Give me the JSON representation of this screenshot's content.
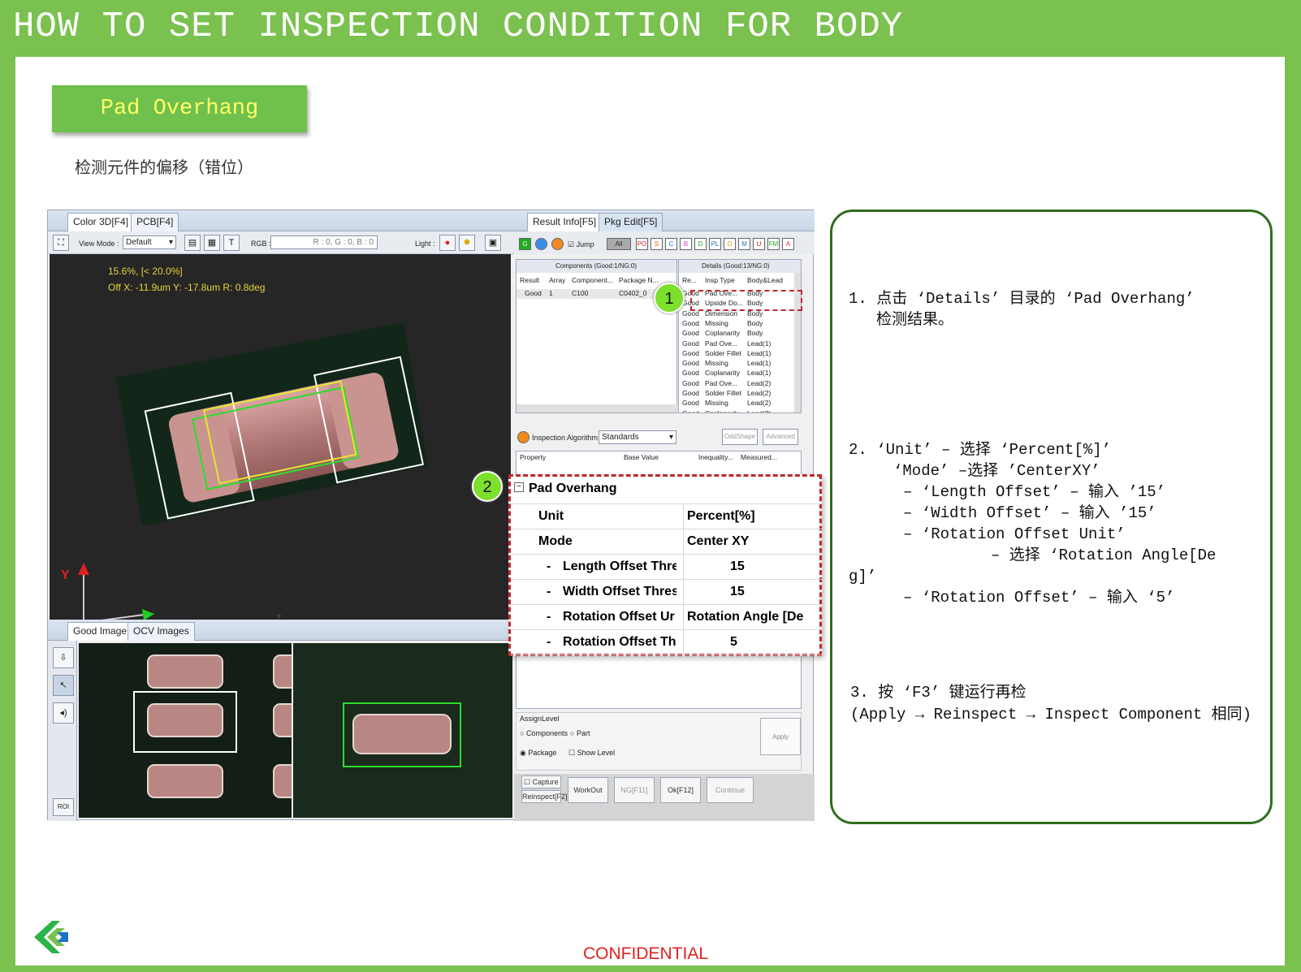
{
  "slide": {
    "title": "HOW TO SET INSPECTION CONDITION FOR BODY",
    "section_tab": "Pad Overhang",
    "subtitle": "检测元件的偏移（错位）",
    "confidential": "CONFIDENTIAL"
  },
  "colors": {
    "frame_green": "#7ac14f",
    "tab_text": "#ffff66",
    "border_dark_green": "#2f6e1c",
    "highlight_red": "#c0272d",
    "callout_green": "#7ce02c"
  },
  "app": {
    "left_tabs": [
      "Color 3D[F4]",
      "PCB[F4]"
    ],
    "toolbar": {
      "view_mode_label": "View Mode :",
      "view_mode_value": "Default",
      "rgb_label": "RGB :",
      "rgb_value": "R : 0, G : 0, B : 0",
      "light_label": "Light :"
    },
    "view3d": {
      "line1": "15.6%, [< 20.0%]",
      "line2": "Off X: -11.9um Y: -17.8um R:   0.8deg",
      "axis_y": "Y",
      "axis_x": "X"
    },
    "lower_tabs": [
      "Good Image",
      "OCV Images"
    ],
    "roi_label": "ROI",
    "right_tabs": [
      "Result Info[F5]",
      "Pkg Edit[F5]"
    ],
    "filter": {
      "jump_label": "Jump",
      "all_label": "All",
      "categories": [
        "PO",
        "S",
        "C",
        "B",
        "D",
        "PL",
        "O",
        "M",
        "U",
        "FM",
        "A"
      ]
    },
    "components_header": "Components (Good:1/NG:0)",
    "components_columns": [
      "Result",
      "Array",
      "Component...",
      "Package N..."
    ],
    "components_rows": [
      [
        "Good",
        "1",
        "C100",
        "C0402_0"
      ]
    ],
    "details_header": "Details (Good:13/NG:0)",
    "details_columns": [
      "Re...",
      "Insp Type",
      "Body&Lead"
    ],
    "details_rows": [
      [
        "Good",
        "Pad Ove...",
        "Body"
      ],
      [
        "Good",
        "Upside Do...",
        "Body"
      ],
      [
        "Good",
        "Dimension",
        "Body"
      ],
      [
        "Good",
        "Missing",
        "Body"
      ],
      [
        "Good",
        "Coplanarity",
        "Body"
      ],
      [
        "Good",
        "Pad Ove...",
        "Lead(1)"
      ],
      [
        "Good",
        "Solder Fillet",
        "Lead(1)"
      ],
      [
        "Good",
        "Missing",
        "Lead(1)"
      ],
      [
        "Good",
        "Coplanarity",
        "Lead(1)"
      ],
      [
        "Good",
        "Pad Ove...",
        "Lead(2)"
      ],
      [
        "Good",
        "Solder Fillet",
        "Lead(2)"
      ],
      [
        "Good",
        "Missing",
        "Lead(2)"
      ],
      [
        "Good",
        "Coplanarity",
        "Lead(2)"
      ]
    ],
    "algo": {
      "label": "Inspection Algorithm",
      "value": "Standards",
      "oddshape": "OddShape",
      "advanced": "Advanced"
    },
    "property_columns": [
      "Property",
      "Base Value",
      "Inequality...",
      "Measured..."
    ],
    "properties": {
      "group": "Pad Overhang",
      "rows": [
        {
          "dash": "",
          "name": "Unit",
          "value": "Percent[%]"
        },
        {
          "dash": "",
          "name": "Mode",
          "value": "Center XY"
        },
        {
          "dash": "-",
          "name": "Length Offset Thre",
          "value": "15"
        },
        {
          "dash": "-",
          "name": "Width Offset Thres",
          "value": "15"
        },
        {
          "dash": "-",
          "name": "Rotation Offset Ur",
          "value": "Rotation Angle [De"
        },
        {
          "dash": "-",
          "name": "Rotation Offset Th",
          "value": "5"
        }
      ]
    },
    "assign": {
      "title": "AssignLevel",
      "components": "Components",
      "part": "Part",
      "package": "Package",
      "show_level": "Show Level",
      "apply": "Apply"
    },
    "bottom_buttons": {
      "capture": "Capture",
      "reinspect": "Reinspect[F2]",
      "workout": "WorkOut",
      "ng": "NG[F11]",
      "ok": "Ok[F12]",
      "continue": "Continue"
    },
    "callouts": [
      "1",
      "2"
    ]
  },
  "instructions": {
    "s1_line1": "1.  点击 ‘Details’ 目录的  ‘Pad Overhang’",
    "s1_line2": "检测结果。",
    "s2_line1": "2.  ‘Unit’  – 选择 ‘Percent[%]’",
    "s2_line2": "‘Mode’  –选择 ’CenterXY’",
    "s2_line3": "–  ‘Length Offset’  – 输入 ’15’",
    "s2_line4": "–  ‘Width Offset’  – 输入 ’15’",
    "s2_line5": "–  ‘Rotation Offset Unit’",
    "s2_line6": "–  选择 ‘Rotation Angle[De",
    "s2_line7": "g]’",
    "s2_line8": "–  ‘Rotation Offset’  – 输入 ‘5’",
    "s3_line1": "3. 按 ‘F3’ 键运行再检",
    "s3_line2": "(Apply → Reinspect → Inspect Component 相同)"
  }
}
